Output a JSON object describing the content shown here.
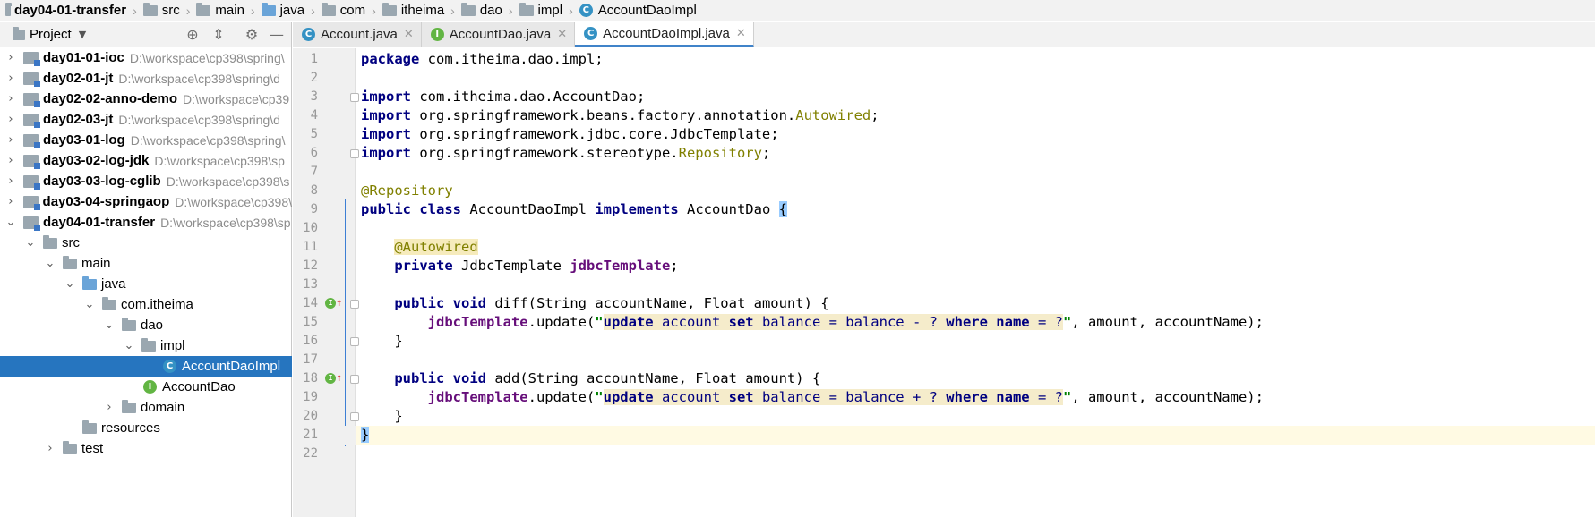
{
  "breadcrumb": {
    "items": [
      "day04-01-transfer",
      "src",
      "main",
      "java",
      "com",
      "itheima",
      "dao",
      "impl",
      "AccountDaoImpl"
    ]
  },
  "project_panel": {
    "title": "Project",
    "modules": [
      {
        "name": "day01-01-ioc",
        "path": "D:\\workspace\\cp398\\spring\\"
      },
      {
        "name": "day02-01-jt",
        "path": "D:\\workspace\\cp398\\spring\\d"
      },
      {
        "name": "day02-02-anno-demo",
        "path": "D:\\workspace\\cp39"
      },
      {
        "name": "day02-03-jt",
        "path": "D:\\workspace\\cp398\\spring\\d"
      },
      {
        "name": "day03-01-log",
        "path": "D:\\workspace\\cp398\\spring\\"
      },
      {
        "name": "day03-02-log-jdk",
        "path": "D:\\workspace\\cp398\\sp"
      },
      {
        "name": "day03-03-log-cglib",
        "path": "D:\\workspace\\cp398\\s"
      },
      {
        "name": "day03-04-springaop",
        "path": "D:\\workspace\\cp398\\"
      },
      {
        "name": "day04-01-transfer",
        "path": "D:\\workspace\\cp398\\sp"
      }
    ],
    "tree": {
      "src": "src",
      "main": "main",
      "java": "java",
      "pkg": "com.itheima",
      "dao": "dao",
      "impl": "impl",
      "impl_class": "AccountDaoImpl",
      "dao_iface": "AccountDao",
      "domain": "domain",
      "resources": "resources",
      "test": "test"
    }
  },
  "tabs": [
    {
      "label": "Account.java",
      "icon": "C",
      "active": false
    },
    {
      "label": "AccountDao.java",
      "icon": "I",
      "active": false
    },
    {
      "label": "AccountDaoImpl.java",
      "icon": "C",
      "active": true
    }
  ],
  "editor": {
    "line_numbers": [
      "1",
      "2",
      "3",
      "4",
      "5",
      "6",
      "7",
      "8",
      "9",
      "10",
      "11",
      "12",
      "13",
      "14",
      "15",
      "16",
      "17",
      "18",
      "19",
      "20",
      "21",
      "22"
    ],
    "code": {
      "l1_kw": "package",
      "l1_rest": " com.itheima.dao.impl;",
      "imp": "import",
      "l3_rest": " com.itheima.dao.AccountDao;",
      "l4_a": " org.springframework.beans.factory.annotation.",
      "l4_b": "Autowired",
      "l4_c": ";",
      "l5_rest": " org.springframework.jdbc.core.JdbcTemplate;",
      "l6_a": " org.springframework.stereotype.",
      "l6_b": "Repository",
      "l6_c": ";",
      "l8_ann": "@Repository",
      "public": "public",
      "class": "class",
      "implements": "implements",
      "private": "private",
      "void": "void",
      "l9_cls": " AccountDaoImpl ",
      "l9_iface": " AccountDao ",
      "brace_open": "{",
      "l11_ann": "@Autowired",
      "l12_type": " JdbcTemplate ",
      "l12_fld": "jdbcTemplate",
      "semi": ";",
      "l14_sig": " diff(String accountName, Float amount) {",
      "fld_ref": "jdbcTemplate",
      "upd": ".update(",
      "quote": "\"",
      "sql_update": "update",
      "sql_account": " account ",
      "sql_set": "set",
      "sql_bal1": " balance = balance ",
      "sql_minus": "-",
      "sql_plus": "+",
      "sql_q": " ? ",
      "sql_where": "where",
      "sql_name": " name ",
      "sql_eq": "= ?",
      "args": ", amount, accountName);",
      "brace_close": "}",
      "l18_sig": " add(String accountName, Float amount) {"
    }
  }
}
